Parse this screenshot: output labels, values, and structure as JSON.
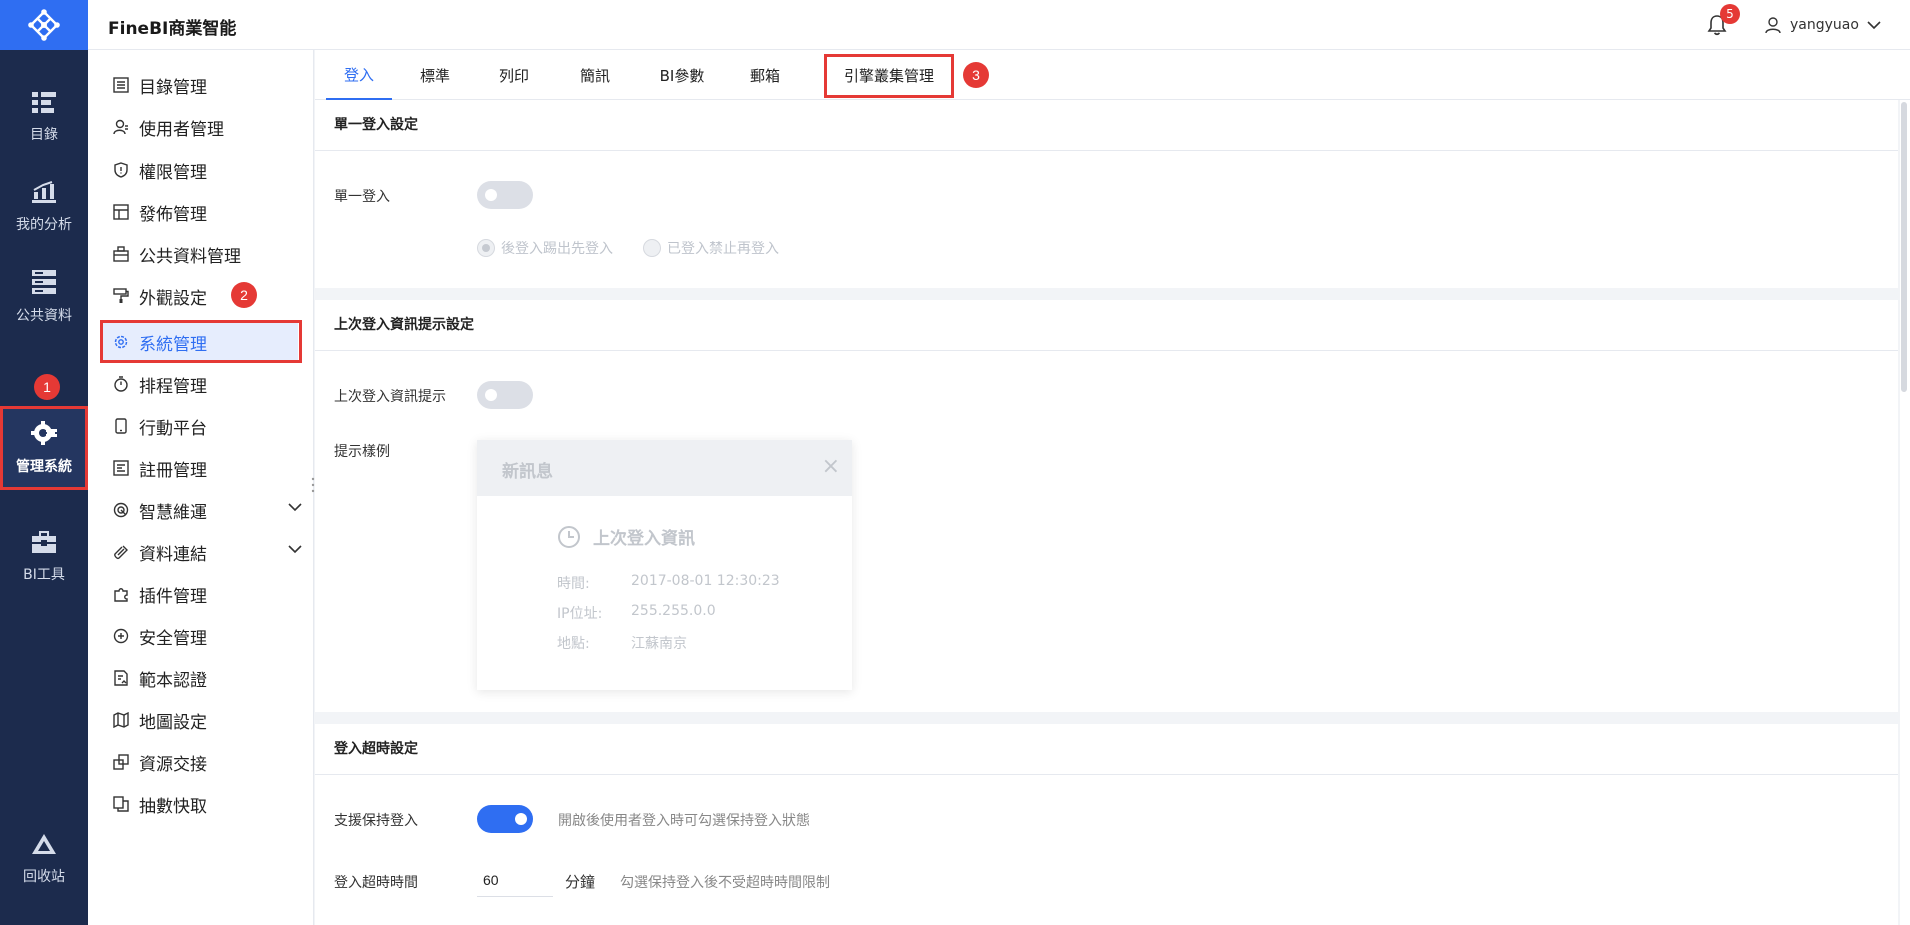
{
  "header": {
    "brand": "FineBI商業智能",
    "notification_count": "5",
    "username": "yangyuao"
  },
  "rail": {
    "items": [
      {
        "label": "目錄",
        "icon": "catalog-icon"
      },
      {
        "label": "我的分析",
        "icon": "analysis-icon"
      },
      {
        "label": "公共資料",
        "icon": "public-data-icon"
      },
      {
        "label": "管理系統",
        "icon": "admin-gear-icon"
      },
      {
        "label": "BI工具",
        "icon": "toolbox-icon"
      },
      {
        "label": "回收站",
        "icon": "recycle-bin-icon"
      }
    ],
    "active_index": 3
  },
  "menu": {
    "items": [
      {
        "label": "目錄管理",
        "icon": "list-icon"
      },
      {
        "label": "使用者管理",
        "icon": "user-icon"
      },
      {
        "label": "權限管理",
        "icon": "shield-icon"
      },
      {
        "label": "發佈管理",
        "icon": "publish-icon"
      },
      {
        "label": "公共資料管理",
        "icon": "briefcase-icon"
      },
      {
        "label": "外觀設定",
        "icon": "paint-roller-icon"
      },
      {
        "label": "系統管理",
        "icon": "gear-icon"
      },
      {
        "label": "排程管理",
        "icon": "stopwatch-icon"
      },
      {
        "label": "行動平台",
        "icon": "mobile-icon"
      },
      {
        "label": "註冊管理",
        "icon": "register-icon"
      },
      {
        "label": "智慧維運",
        "icon": "radar-icon"
      },
      {
        "label": "資料連結",
        "icon": "link-icon"
      },
      {
        "label": "插件管理",
        "icon": "puzzle-icon"
      },
      {
        "label": "安全管理",
        "icon": "security-plus-icon"
      },
      {
        "label": "範本認證",
        "icon": "template-cert-icon"
      },
      {
        "label": "地圖設定",
        "icon": "map-icon"
      },
      {
        "label": "資源交接",
        "icon": "resource-swap-icon"
      },
      {
        "label": "抽數快取",
        "icon": "cache-copy-icon"
      }
    ],
    "active_index": 6
  },
  "tabs": {
    "items": [
      "登入",
      "標準",
      "列印",
      "簡訊",
      "BI參數",
      "郵箱",
      "引擎叢集管理"
    ],
    "active_index": 0
  },
  "annotations": {
    "rail_badge": "1",
    "menu_badge": "2",
    "tab_badge": "3"
  },
  "sso": {
    "title": "單一登入設定",
    "label": "單一登入",
    "enabled": false,
    "option_kick": "後登入踢出先登入",
    "option_block": "已登入禁止再登入"
  },
  "last_login": {
    "title": "上次登入資訊提示設定",
    "label": "上次登入資訊提示",
    "enabled": false,
    "example_label": "提示樣例",
    "preview_title": "新訊息",
    "preview_subtitle": "上次登入資訊",
    "time_label": "時間:",
    "time_value": "2017-08-01 12:30:23",
    "ip_label": "IP位址:",
    "ip_value": "255.255.0.0",
    "location_label": "地點:",
    "location_value": "江蘇南京"
  },
  "timeout": {
    "title": "登入超時設定",
    "keep_label": "支援保持登入",
    "keep_enabled": true,
    "keep_hint": "開啟後使用者登入時可勾選保持登入狀態",
    "duration_label": "登入超時時間",
    "duration_value": "60",
    "duration_unit": "分鐘",
    "duration_hint": "勾選保持登入後不受超時時間限制"
  },
  "colors": {
    "accent": "#2f6ef2",
    "rail_bg": "#1c2b4d",
    "highlight_red": "#e53935"
  }
}
